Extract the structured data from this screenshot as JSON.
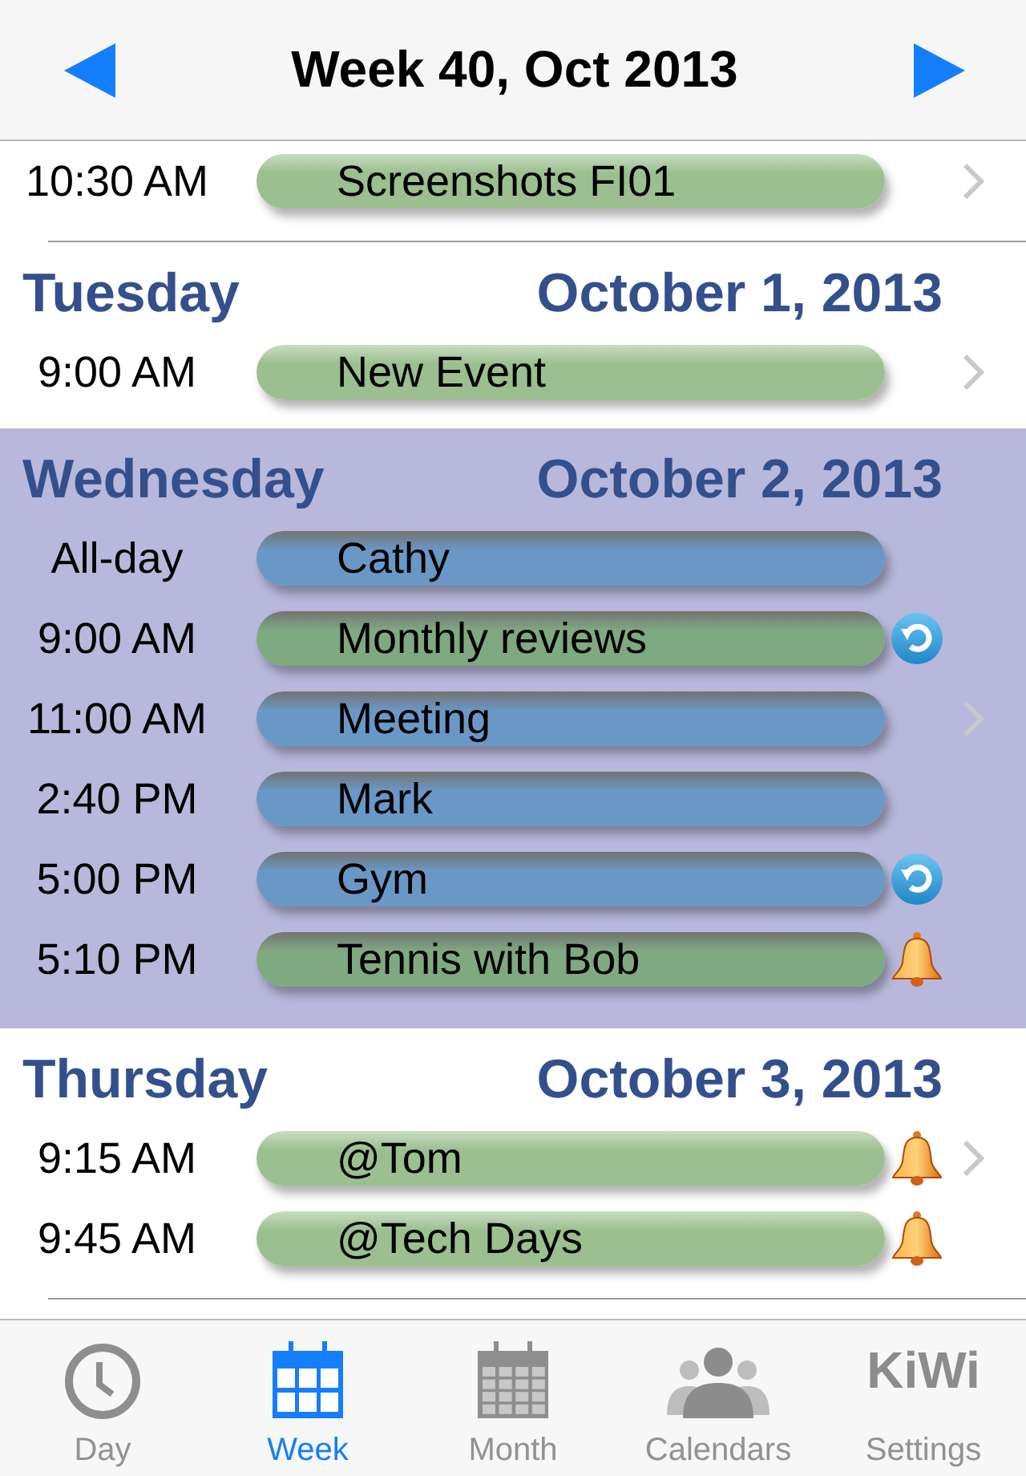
{
  "header": {
    "title": "Week 40, Oct 2013"
  },
  "sections": [
    {
      "selected": false,
      "events": [
        {
          "time": "10:30 AM",
          "title": "Screenshots FI01",
          "color": "#9bbf8e",
          "repeating": false,
          "alarm": false,
          "chevron": true
        }
      ]
    },
    {
      "day": "Tuesday",
      "date": "October 1, 2013",
      "selected": false,
      "events": [
        {
          "time": "9:00 AM",
          "title": "New Event",
          "color": "#9bbf8e",
          "repeating": false,
          "alarm": false,
          "chevron": true
        }
      ]
    },
    {
      "day": "Wednesday",
      "date": "October 2, 2013",
      "selected": true,
      "events": [
        {
          "time": "All-day",
          "title": "Cathy",
          "color": "#6a98c6",
          "repeating": false,
          "alarm": false,
          "chevron": false
        },
        {
          "time": "9:00 AM",
          "title": "Monthly reviews",
          "color": "#7fa981",
          "repeating": true,
          "alarm": false,
          "chevron": false
        },
        {
          "time": "11:00 AM",
          "title": "Meeting",
          "color": "#6a98c6",
          "repeating": false,
          "alarm": false,
          "chevron": true
        },
        {
          "time": "2:40 PM",
          "title": "Mark",
          "color": "#6a98c6",
          "repeating": false,
          "alarm": false,
          "chevron": false
        },
        {
          "time": "5:00 PM",
          "title": "Gym",
          "color": "#6a98c6",
          "repeating": true,
          "alarm": false,
          "chevron": false
        },
        {
          "time": "5:10 PM",
          "title": "Tennis with Bob",
          "color": "#7fa981",
          "repeating": false,
          "alarm": true,
          "chevron": false
        }
      ]
    },
    {
      "day": "Thursday",
      "date": "October 3, 2013",
      "selected": false,
      "events": [
        {
          "time": "9:15 AM",
          "title": "@Tom",
          "color": "#9bbf8e",
          "repeating": false,
          "alarm": true,
          "chevron": true
        },
        {
          "time": "9:45 AM",
          "title": "@Tech Days",
          "color": "#9bbf8e",
          "repeating": false,
          "alarm": true,
          "chevron": false
        }
      ]
    }
  ],
  "tab_bar": [
    {
      "kind": "clock",
      "label": "Day",
      "selected": false
    },
    {
      "kind": "week",
      "label": "Week",
      "selected": true
    },
    {
      "kind": "month",
      "label": "Month",
      "selected": false
    },
    {
      "kind": "people",
      "label": "Calendars",
      "selected": false
    },
    {
      "kind": "text",
      "icon_text": "KiWi",
      "label": "Settings",
      "selected": false
    }
  ]
}
